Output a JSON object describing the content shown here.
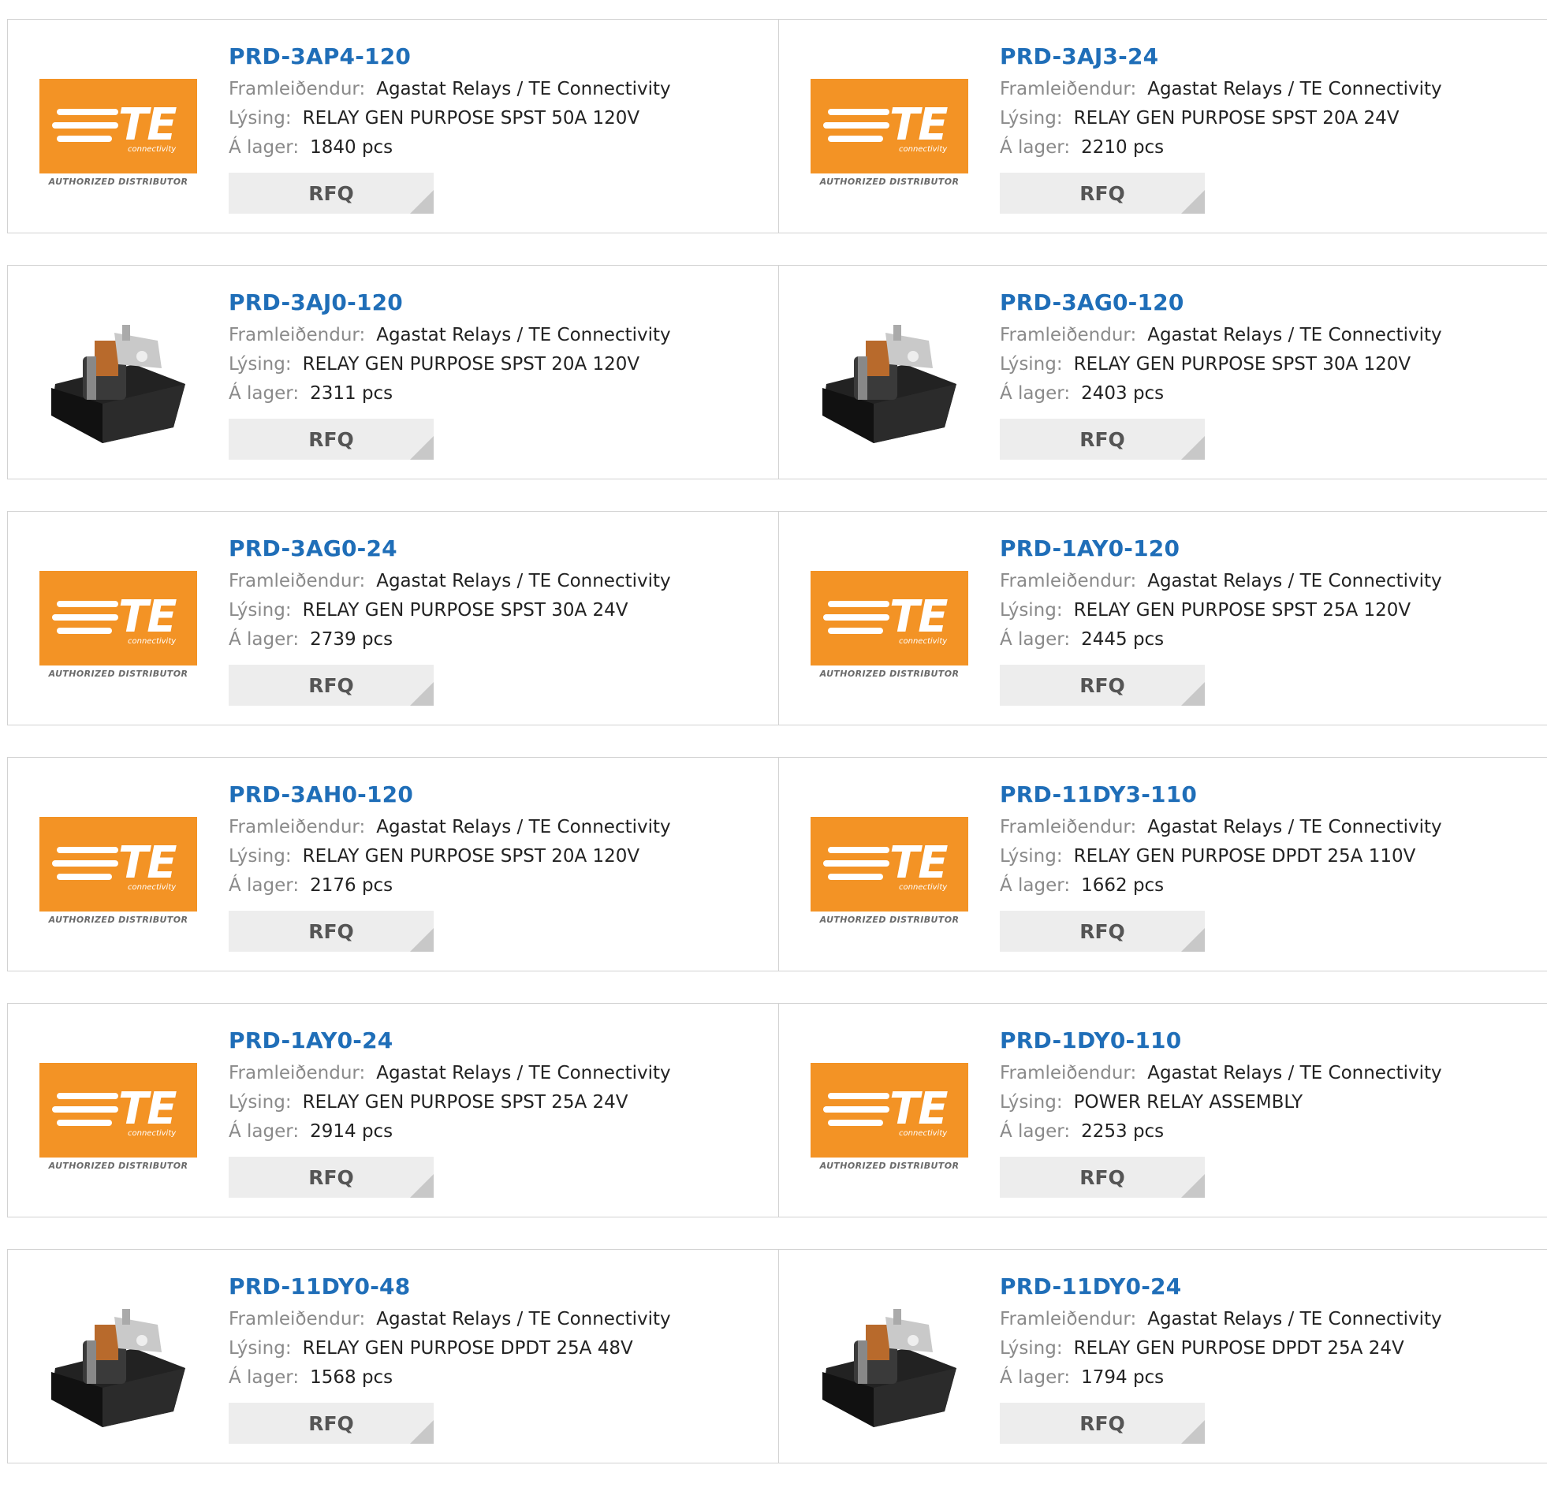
{
  "labels": {
    "manufacturer": "Framleiðendur:",
    "description": "Lýsing:",
    "stock": "Á lager:",
    "rfq": "RFQ",
    "logo_authorized": "AUTHORIZED DISTRIBUTOR",
    "logo_brand": "TE",
    "logo_sub": "connectivity"
  },
  "colors": {
    "part_link": "#1f6eb8",
    "logo_orange": "#f39325",
    "rfq_bg": "#ededed"
  },
  "products": [
    {
      "part": "PRD-3AP4-120",
      "manufacturer": "Agastat Relays / TE Connectivity",
      "description": "RELAY GEN PURPOSE SPST 50A 120V",
      "stock": "1840 pcs",
      "image": "te-logo"
    },
    {
      "part": "PRD-3AJ3-24",
      "manufacturer": "Agastat Relays / TE Connectivity",
      "description": "RELAY GEN PURPOSE SPST 20A 24V",
      "stock": "2210 pcs",
      "image": "te-logo"
    },
    {
      "part": "PRD-3AJ0-120",
      "manufacturer": "Agastat Relays / TE Connectivity",
      "description": "RELAY GEN PURPOSE SPST 20A 120V",
      "stock": "2311 pcs",
      "image": "relay-photo"
    },
    {
      "part": "PRD-3AG0-120",
      "manufacturer": "Agastat Relays / TE Connectivity",
      "description": "RELAY GEN PURPOSE SPST 30A 120V",
      "stock": "2403 pcs",
      "image": "relay-photo"
    },
    {
      "part": "PRD-3AG0-24",
      "manufacturer": "Agastat Relays / TE Connectivity",
      "description": "RELAY GEN PURPOSE SPST 30A 24V",
      "stock": "2739 pcs",
      "image": "te-logo"
    },
    {
      "part": "PRD-1AY0-120",
      "manufacturer": "Agastat Relays / TE Connectivity",
      "description": "RELAY GEN PURPOSE SPST 25A 120V",
      "stock": "2445 pcs",
      "image": "te-logo"
    },
    {
      "part": "PRD-3AH0-120",
      "manufacturer": "Agastat Relays / TE Connectivity",
      "description": "RELAY GEN PURPOSE SPST 20A 120V",
      "stock": "2176 pcs",
      "image": "te-logo"
    },
    {
      "part": "PRD-11DY3-110",
      "manufacturer": "Agastat Relays / TE Connectivity",
      "description": "RELAY GEN PURPOSE DPDT 25A 110V",
      "stock": "1662 pcs",
      "image": "te-logo"
    },
    {
      "part": "PRD-1AY0-24",
      "manufacturer": "Agastat Relays / TE Connectivity",
      "description": "RELAY GEN PURPOSE SPST 25A 24V",
      "stock": "2914 pcs",
      "image": "te-logo"
    },
    {
      "part": "PRD-1DY0-110",
      "manufacturer": "Agastat Relays / TE Connectivity",
      "description": "POWER RELAY ASSEMBLY",
      "stock": "2253 pcs",
      "image": "te-logo"
    },
    {
      "part": "PRD-11DY0-48",
      "manufacturer": "Agastat Relays / TE Connectivity",
      "description": "RELAY GEN PURPOSE DPDT 25A 48V",
      "stock": "1568 pcs",
      "image": "relay-photo"
    },
    {
      "part": "PRD-11DY0-24",
      "manufacturer": "Agastat Relays / TE Connectivity",
      "description": "RELAY GEN PURPOSE DPDT 25A 24V",
      "stock": "1794 pcs",
      "image": "relay-photo"
    }
  ]
}
